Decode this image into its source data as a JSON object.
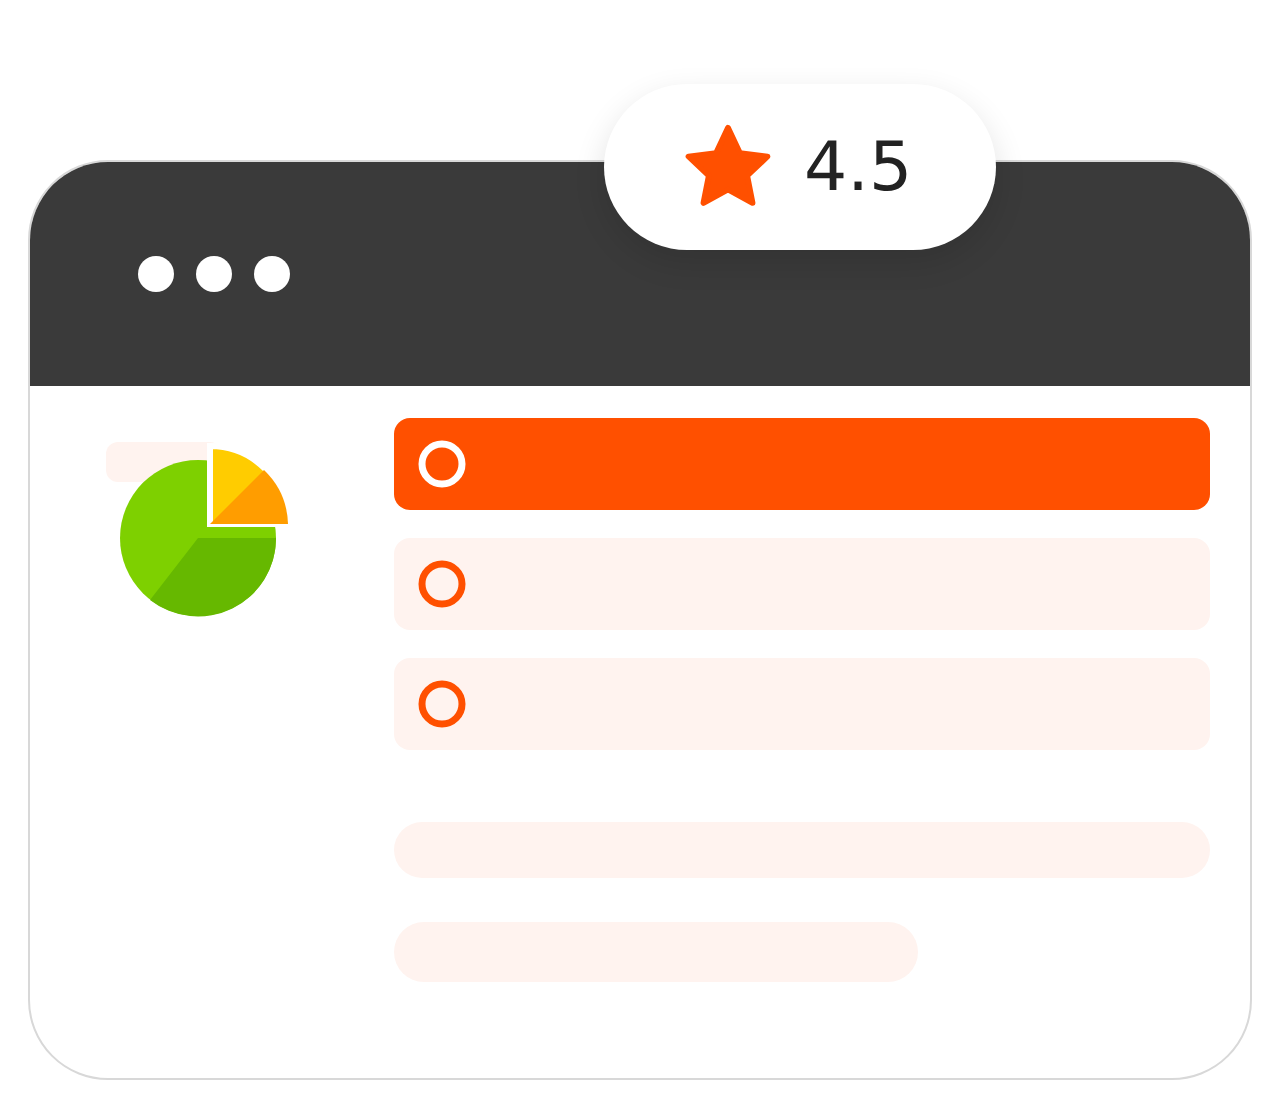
{
  "rating": {
    "value": "4.5"
  },
  "options": [
    {
      "selected": true
    },
    {
      "selected": false
    },
    {
      "selected": false
    }
  ]
}
